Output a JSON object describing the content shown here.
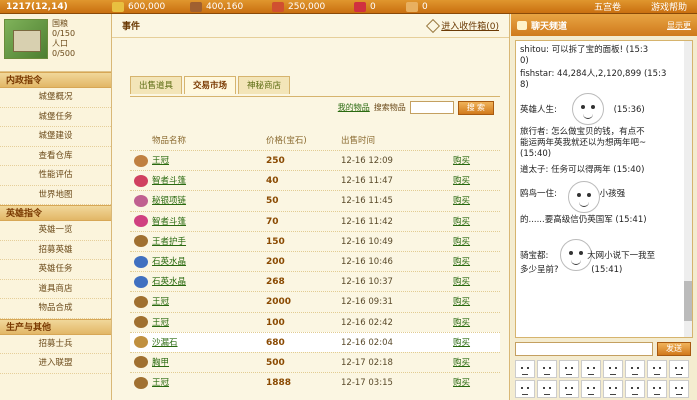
{
  "topbar": {
    "date": "1217(12,14)",
    "resources": [
      {
        "icon": "coin-icon",
        "value": "600,000",
        "color": "#e8c040"
      },
      {
        "icon": "wood-icon",
        "value": "400,160",
        "color": "#a06030"
      },
      {
        "icon": "food-icon",
        "value": "250,000",
        "color": "#d05030"
      },
      {
        "icon": "gem-icon",
        "value": "0",
        "color": "#d03040"
      },
      {
        "icon": "people-icon",
        "value": "0",
        "color": "#e8b060"
      }
    ],
    "right_links": [
      "五宫卷",
      "游戏帮助"
    ]
  },
  "profile": {
    "lines": [
      "国粮",
      "0/150",
      "人口",
      "0/500"
    ]
  },
  "sidebar": {
    "sections": [
      {
        "title": "内政指令",
        "items": [
          "城堡概况",
          "城堡任务",
          "城堡建设",
          "查看仓库",
          "性能评估",
          "世界地图"
        ]
      },
      {
        "title": "英雄指令",
        "items": [
          "英雄一览",
          "招募英雄",
          "英雄任务",
          "道具商店",
          "物品合成"
        ]
      },
      {
        "title": "生产与其他",
        "items": [
          "招募士兵",
          "进入联盟"
        ]
      }
    ]
  },
  "main": {
    "title": "事件",
    "link": "进入收件箱(0)",
    "tabs": [
      "出售道具",
      "交易市场",
      "神秘商店"
    ],
    "search": {
      "link": "我的物品",
      "label": "搜索物品",
      "placeholder": "",
      "button": "搜 索"
    },
    "headers": [
      "物品名称",
      "价格(宝石)",
      "出售时间"
    ],
    "rows": [
      {
        "icon_color": "#c08040",
        "name": "王冠",
        "price": "250",
        "time": "12-16 12:09",
        "action": "购买"
      },
      {
        "icon_color": "#d04060",
        "name": "智者斗篷",
        "price": "40",
        "time": "12-16 11:47",
        "action": "购买"
      },
      {
        "icon_color": "#c06090",
        "name": "秘银项链",
        "price": "50",
        "time": "12-16 11:45",
        "action": "购买"
      },
      {
        "icon_color": "#d04080",
        "name": "智者斗篷",
        "price": "70",
        "time": "12-16 11:42",
        "action": "购买"
      },
      {
        "icon_color": "#a07030",
        "name": "王者护手",
        "price": "150",
        "time": "12-16 10:49",
        "action": "购买"
      },
      {
        "icon_color": "#4070c0",
        "name": "石英水晶",
        "price": "200",
        "time": "12-16 10:46",
        "action": "购买"
      },
      {
        "icon_color": "#4070c0",
        "name": "石英水晶",
        "price": "268",
        "time": "12-16 10:37",
        "action": "购买"
      },
      {
        "icon_color": "#a07030",
        "name": "王冠",
        "price": "2000",
        "time": "12-16 09:31",
        "action": "购买"
      },
      {
        "icon_color": "#a07030",
        "name": "王冠",
        "price": "100",
        "time": "12-16 02:42",
        "action": "购买"
      },
      {
        "icon_color": "#c09040",
        "name": "沙漏石",
        "price": "680",
        "time": "12-16 02:04",
        "action": "购买"
      },
      {
        "icon_color": "#a07030",
        "name": "胸甲",
        "price": "500",
        "time": "12-17 02:18",
        "action": "购买"
      },
      {
        "icon_color": "#a07030",
        "name": "王冠",
        "price": "1888",
        "time": "12-17 03:15",
        "action": "购买"
      }
    ]
  },
  "chat": {
    "title": "聊天频道",
    "refresh": "显示更",
    "messages": [
      {
        "text": "shitou: 可以拆了宝的面板! (15:3",
        "cont": "0)"
      },
      {
        "text": "fishstar: 44,284人,2,120,899 (15:3",
        "cont": "8)"
      },
      {
        "text": "英雄人生:",
        "cont": "(15:36)"
      },
      {
        "text": "旅行者: 怎么做宝贝的钱，有点不",
        "cont": "能运两年英我就还以为想两年吧~"
      },
      {
        "text": "(15:40)",
        "cont": ""
      },
      {
        "text": "道太子: 任务可以得两年 (15:40)",
        "cont": ""
      },
      {
        "text": "鸥鸟一住:",
        "cont": "小孩强"
      },
      {
        "text": "的......要高级信仍英国军",
        "cont": "(15:41)"
      },
      {
        "text": "骑宝都:",
        "cont": "大网小说下一我至"
      },
      {
        "text": "多少呈前?",
        "cont": "(15:41)"
      }
    ],
    "send": "发送",
    "emotes": 16
  }
}
